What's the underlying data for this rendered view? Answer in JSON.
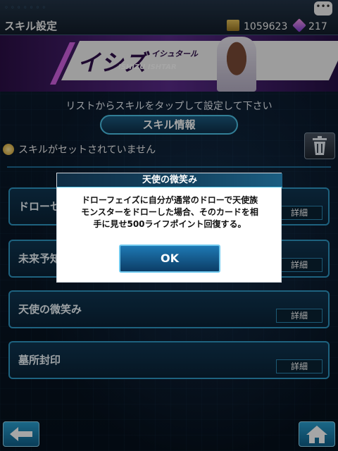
{
  "header": {
    "title": "スキル設定",
    "coins": "1059623",
    "gems": "217",
    "coin_color": "#d8b044",
    "gem_color": "#c06be0"
  },
  "banner": {
    "character_name": "イシズ・イシュタール",
    "name_katakana_main": "イシズ",
    "name_katakana_ruby": "イシュタール",
    "name_roman": "ISHIZU ISHTAR"
  },
  "instruction": "リストからスキルをタップして設定して下さい",
  "skill_info_tab": "スキル情報",
  "status": {
    "text": "スキルがセットされていません"
  },
  "skills": [
    {
      "name": "ドローセ",
      "detail_label": "詳細"
    },
    {
      "name": "未来予知",
      "detail_label": "詳細"
    },
    {
      "name": "天使の微笑み",
      "detail_label": "詳細"
    },
    {
      "name": "墓所封印",
      "detail_label": "詳細"
    }
  ],
  "dialog": {
    "title": "天使の微笑み",
    "line1": "ドローフェイズに自分が通常のドローで天使族",
    "line2": "モンスターをドローした場合、そのカードを相",
    "line3": "手に見せ500ライフポイント回復する。",
    "ok_label": "OK"
  },
  "icons": {
    "back": "back-arrow-icon",
    "home": "home-icon",
    "trash": "trash-icon",
    "chat": "chat-icon",
    "coin": "coin-icon",
    "gem": "gem-icon"
  },
  "colors": {
    "accent": "#2e97c4",
    "header_bg": "#1b2633",
    "dialog_bg": "#ffffff"
  }
}
